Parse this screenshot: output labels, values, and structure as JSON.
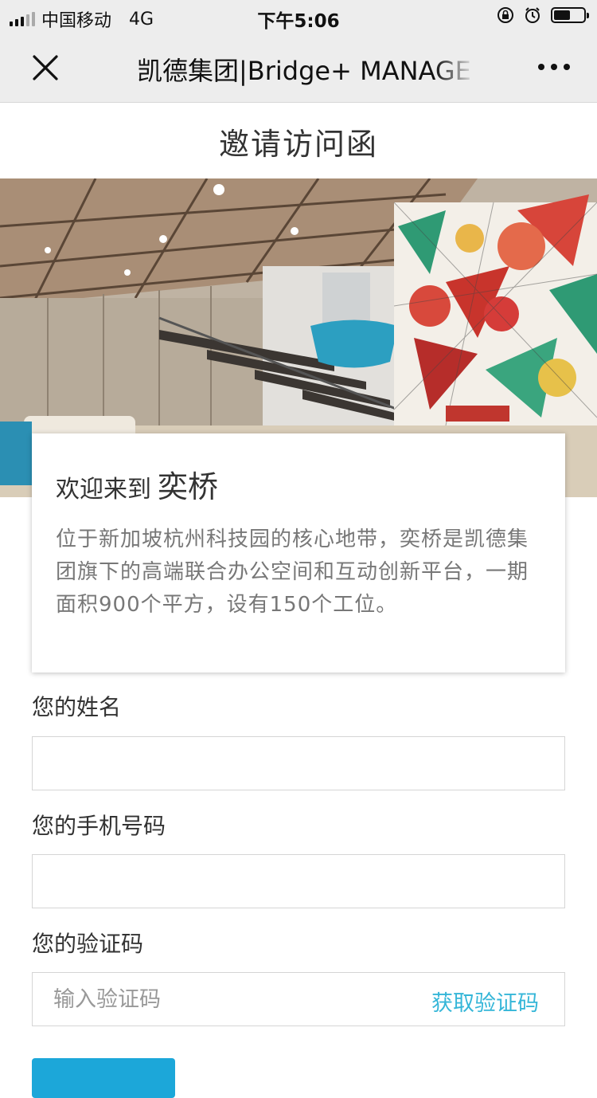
{
  "status_bar": {
    "carrier": "中国移动",
    "network": "4G",
    "time": "下午5:06",
    "battery_level": 0.55
  },
  "nav": {
    "title": "凯德集团|Bridge+ MANAGE"
  },
  "page": {
    "title": "邀请访问函"
  },
  "welcome": {
    "prefix": "欢迎来到",
    "name": "奕桥",
    "description": "位于新加坡杭州科技园的核心地带，奕桥是凯德集团旗下的高端联合办公空间和互动创新平台，一期面积900个平方，设有150个工位。"
  },
  "form": {
    "name_label": "您的姓名",
    "name_value": "",
    "phone_label": "您的手机号码",
    "phone_value": "",
    "code_label": "您的验证码",
    "code_placeholder": "输入验证码",
    "get_code_label": "获取验证码"
  },
  "colors": {
    "accent": "#35b6d8",
    "button": "#1ca7d9"
  },
  "icons": [
    "signal-icon",
    "close-icon",
    "more-icon",
    "orientation-lock-icon",
    "alarm-icon",
    "battery-icon"
  ]
}
